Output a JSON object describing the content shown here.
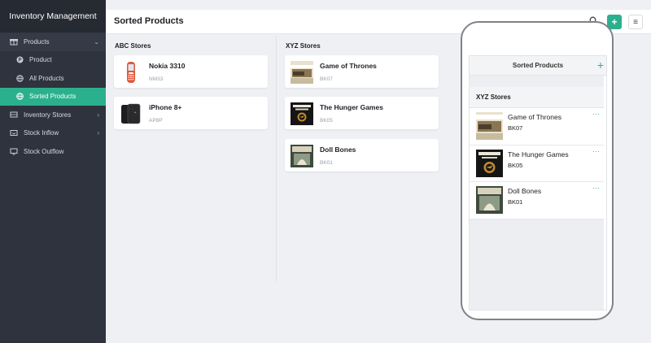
{
  "sidebar": {
    "app_title": "Inventory Management",
    "items": [
      {
        "label": "Products",
        "icon": "gift-icon"
      },
      {
        "label": "Product",
        "icon": "product-icon"
      },
      {
        "label": "All Products",
        "icon": "globe-icon"
      },
      {
        "label": "Sorted Products",
        "icon": "globe-icon"
      },
      {
        "label": "Inventory Stores",
        "icon": "store-icon"
      },
      {
        "label": "Stock Inflow",
        "icon": "inflow-icon"
      },
      {
        "label": "Stock Outflow",
        "icon": "monitor-icon"
      }
    ]
  },
  "header": {
    "title": "Sorted Products",
    "add_label": "+",
    "menu_label": "≡",
    "search_label": "⌕"
  },
  "columns": [
    {
      "title": "ABC Stores",
      "items": [
        {
          "name": "Nokia 3310",
          "code": "NM33"
        },
        {
          "name": "iPhone 8+",
          "code": "AP8P"
        }
      ]
    },
    {
      "title": "XYZ Stores",
      "items": [
        {
          "name": "Game of Thrones",
          "code": "BK07"
        },
        {
          "name": "The Hunger Games",
          "code": "BK05"
        },
        {
          "name": "Doll Bones",
          "code": "BK01"
        }
      ]
    }
  ],
  "phone": {
    "title": "Sorted Products",
    "plus_label": "+",
    "store_title": "XYZ Stores",
    "more_label": "···",
    "items": [
      {
        "name": "Game of Thrones",
        "code": "BK07"
      },
      {
        "name": "The Hunger Games",
        "code": "BK05"
      },
      {
        "name": "Doll Bones",
        "code": "BK01"
      }
    ]
  },
  "colors": {
    "accent": "#2bb08e",
    "sidebar": "#2f333e",
    "sidebar_header": "#262a33"
  }
}
